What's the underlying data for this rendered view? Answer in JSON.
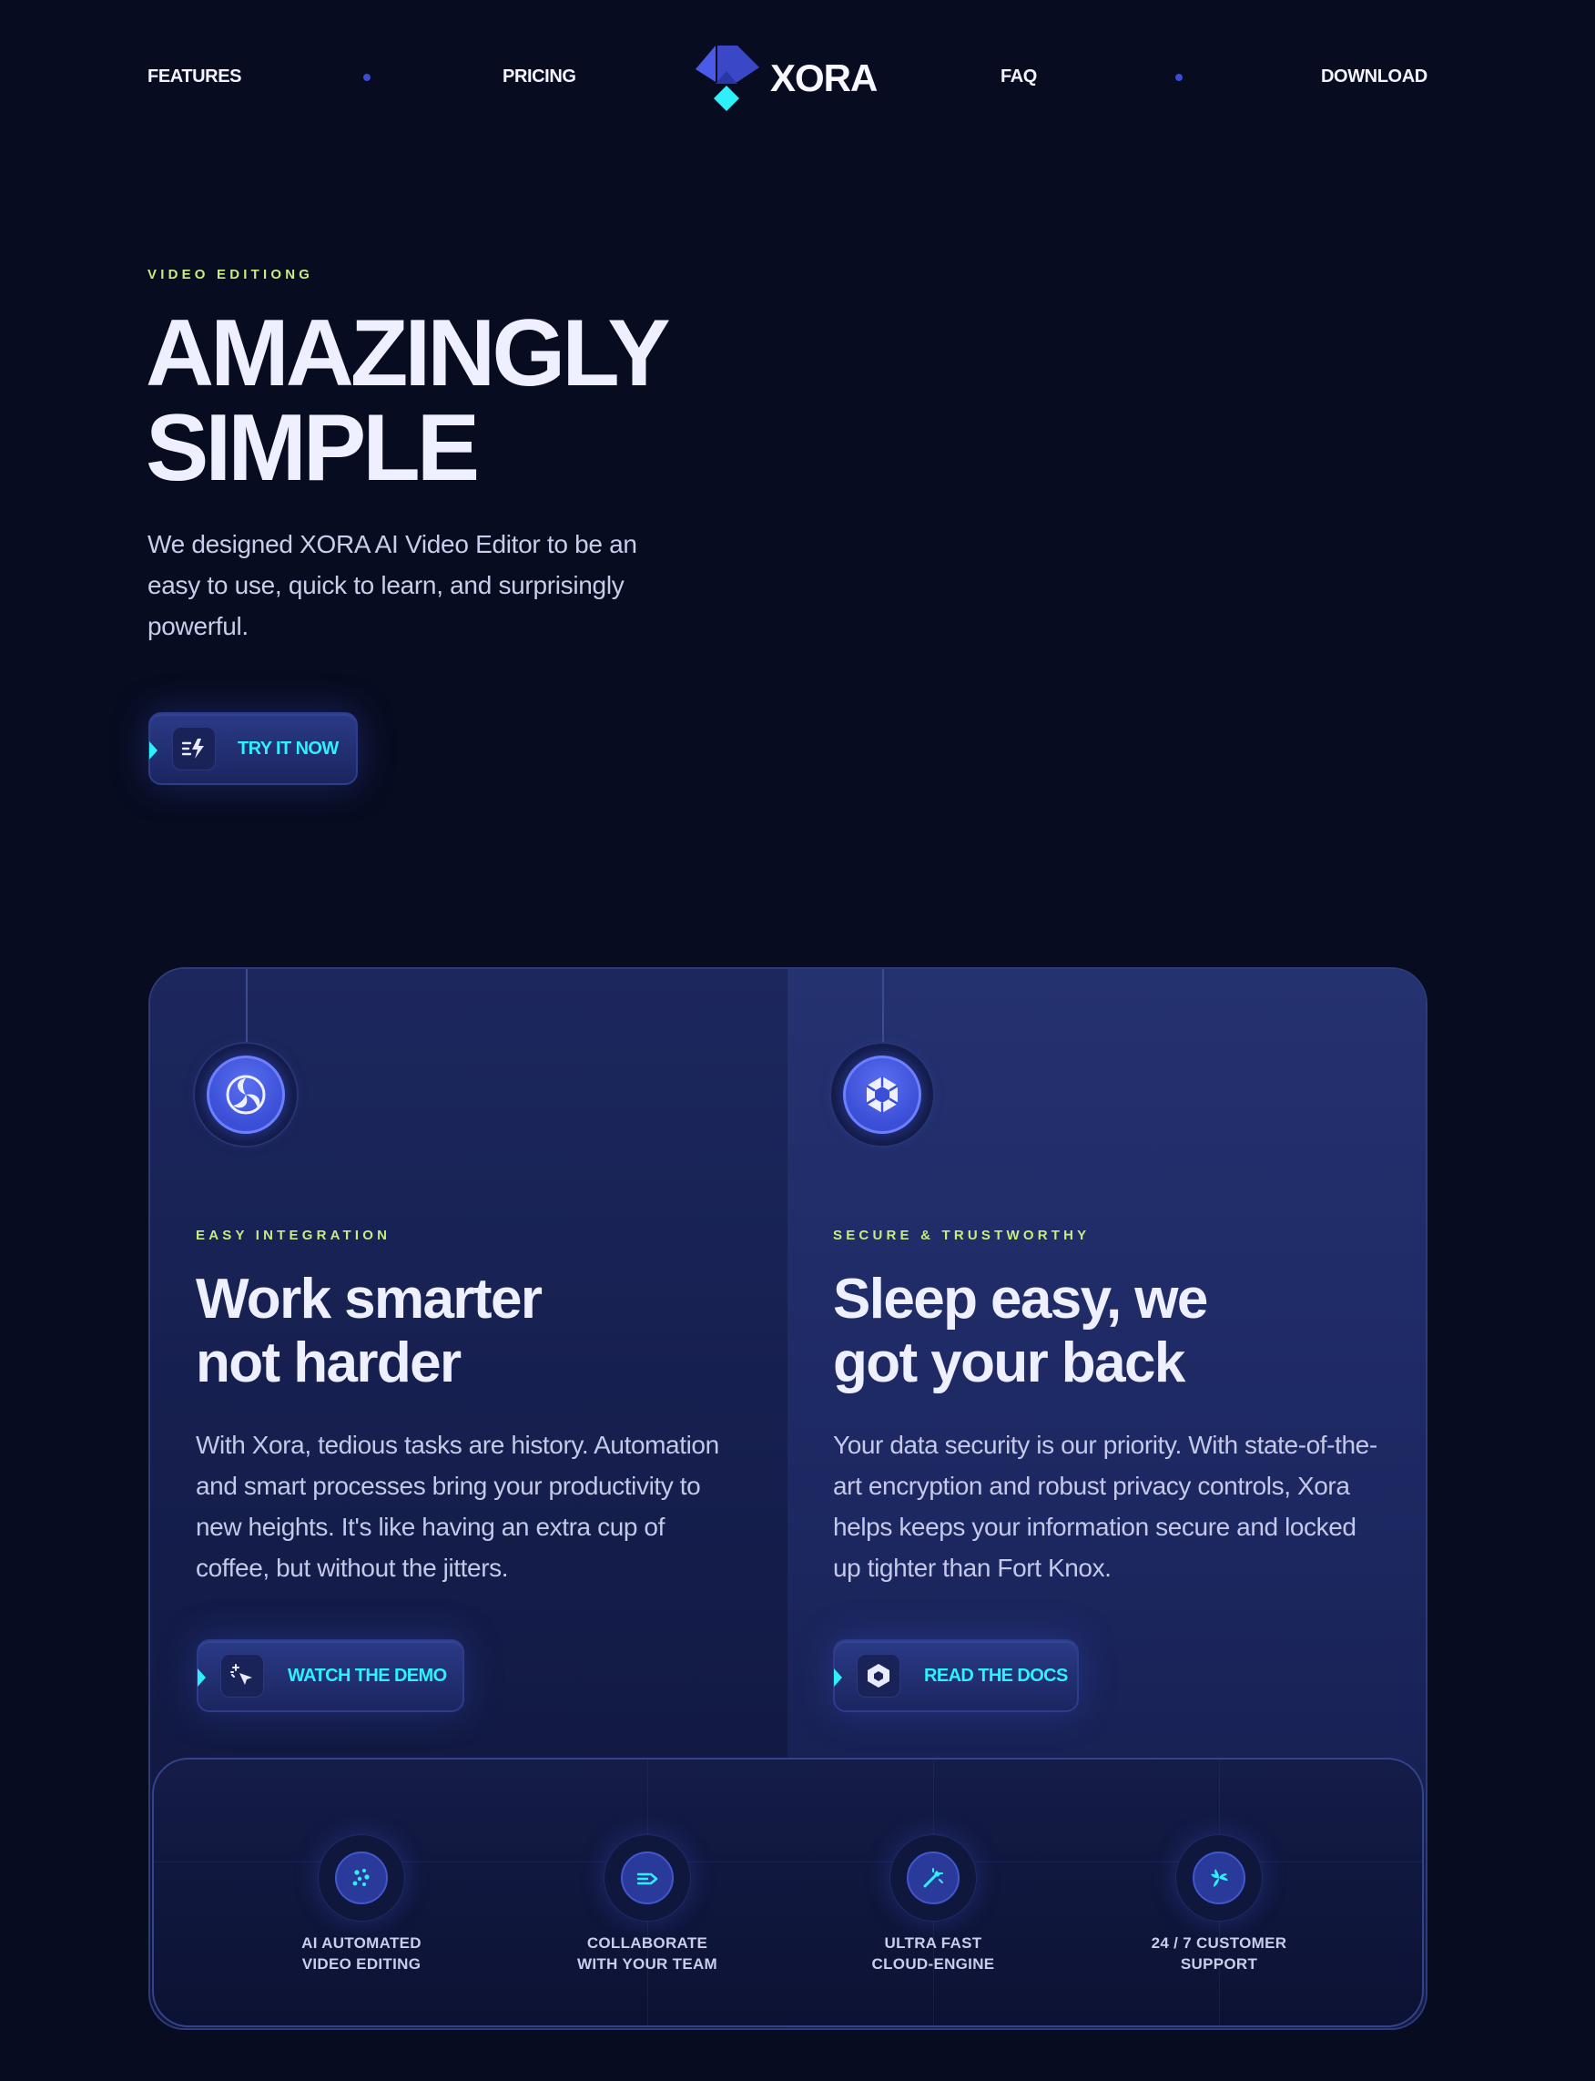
{
  "nav": {
    "links": [
      "Features",
      "Pricing",
      "FAQ",
      "Download"
    ],
    "logo_text": "XORA"
  },
  "hero": {
    "eyebrow": "Video Editiong",
    "title_lines": [
      "Amazingly",
      "Simple"
    ],
    "description": "We designed XORA AI Video Editor to be an easy to use, quick to learn, and surprisingly powerful.",
    "cta_label": "Try it now",
    "cta_icon": "zap-icon"
  },
  "features": [
    {
      "eyebrow": "Easy integration",
      "title_lines": [
        "Work smarter",
        "not harder"
      ],
      "text": "With Xora, tedious tasks are history. Automation and smart processes bring your productivity to new heights. It's like having an extra cup of coffee, but without the jitters.",
      "button_label": "Watch the demo",
      "icon": "swirl-icon",
      "button_icon": "magic-cursor-icon"
    },
    {
      "eyebrow": "Secure & Trustworthy",
      "title_lines": [
        "Sleep easy, we",
        "got your back"
      ],
      "text": "Your data security is our priority. With state-of-the-art encryption and robust privacy controls, Xora helps keeps your information secure and locked up tighter than Fort Knox.",
      "button_label": "Read the docs",
      "icon": "shield-hex-icon",
      "button_icon": "docs-hex-icon"
    }
  ],
  "details": [
    {
      "line1": "AI automated",
      "line2": "video editing",
      "icon": "ai-sparkle-icon"
    },
    {
      "line1": "Collaborate",
      "line2": "with your team",
      "icon": "collaborate-arrows-icon"
    },
    {
      "line1": "Ultra fast",
      "line2": "cloud-engine",
      "icon": "rocket-wand-icon"
    },
    {
      "line1": "24 / 7 customer",
      "line2": "support",
      "icon": "support-spin-icon"
    }
  ],
  "colors": {
    "background": "#080c21",
    "accent_cyan": "#2ff0ff",
    "accent_lime": "#c7ed80",
    "accent_blue": "#3a4ed6"
  }
}
